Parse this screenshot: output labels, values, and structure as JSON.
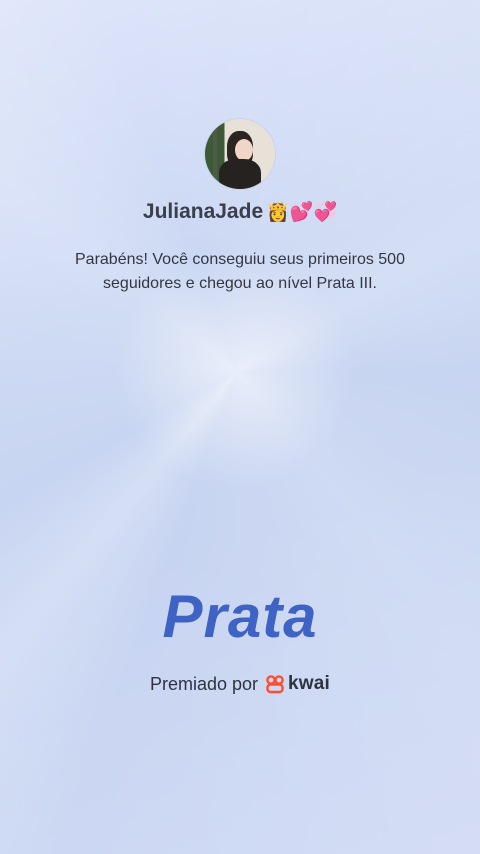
{
  "profile": {
    "username": "JulianaJade",
    "username_emojis": "👸💕💞",
    "avatar_icon": "user-avatar"
  },
  "message": "Parabéns! Você conseguiu seus primeiros 500 seguidores e chegou ao nível Prata III.",
  "rank": {
    "title": "Prata",
    "color": "#3e63c4"
  },
  "footer": {
    "awarded_by": "Premiado por",
    "brand": "kwai",
    "brand_icon": "kwai-logo-icon",
    "brand_color": "#ff4d2e"
  }
}
